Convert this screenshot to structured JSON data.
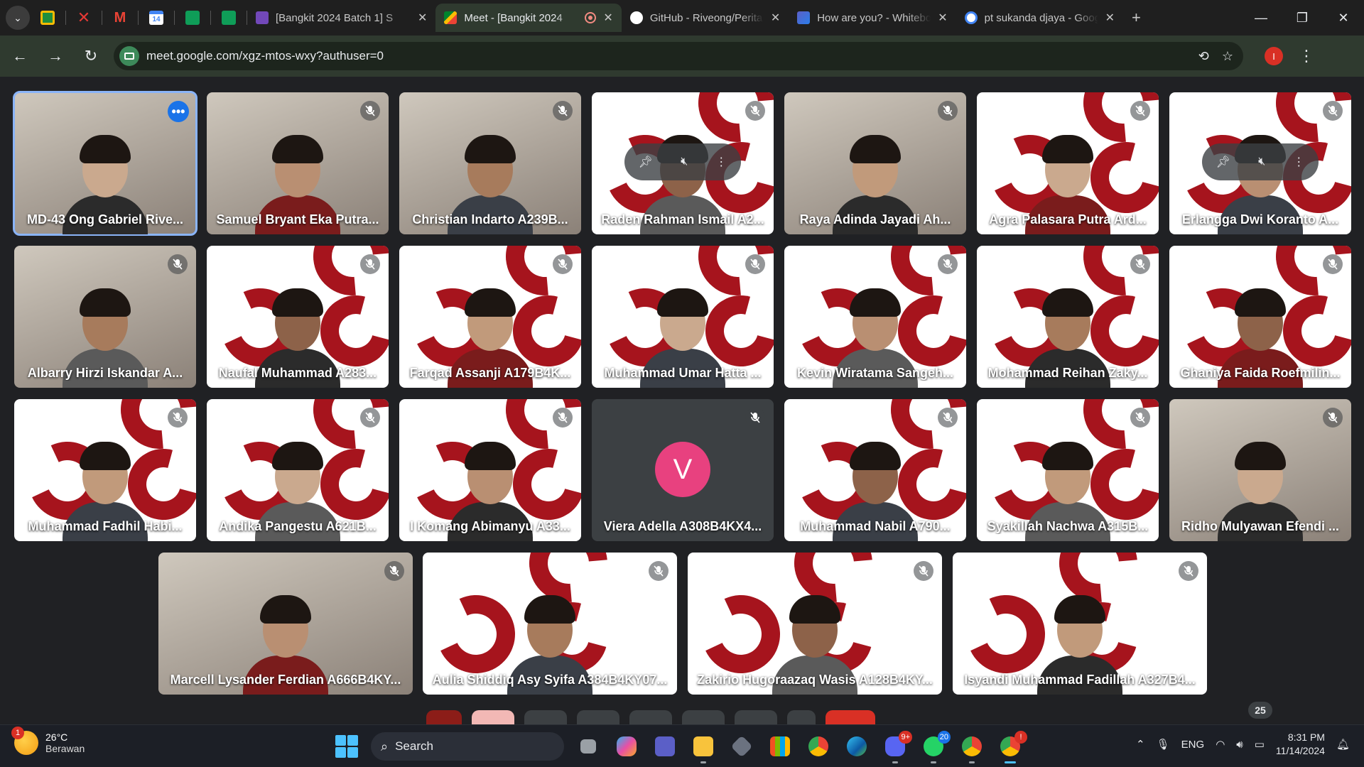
{
  "browser": {
    "tabs": [
      {
        "title": "[Bangkit 2024 Batch 1] S",
        "favicon": "forms-icon",
        "active": false
      },
      {
        "title": "Meet - [Bangkit 2024",
        "favicon": "meet-icon",
        "active": true
      },
      {
        "title": "GitHub - Riveong/Perita",
        "favicon": "github-icon",
        "active": false
      },
      {
        "title": "How are you? - Whitebo",
        "favicon": "whiteboard-icon",
        "active": false
      },
      {
        "title": "pt sukanda djaya - Goog",
        "favicon": "google-icon",
        "active": false
      }
    ],
    "url": "meet.google.com/xgz-mtos-wxy?authuser=0",
    "profile_initial": "I",
    "pinned_badge": "14"
  },
  "participants": [
    {
      "name": "MD-43 Ong Gabriel Rive...",
      "view": "video",
      "active": true
    },
    {
      "name": "Samuel Bryant Eka Putra...",
      "view": "video"
    },
    {
      "name": "Christian Indarto A239B...",
      "view": "video"
    },
    {
      "name": "Raden Rahman Ismail A2...",
      "view": "brand",
      "hover": true
    },
    {
      "name": "Raya Adinda Jayadi Ah...",
      "view": "video"
    },
    {
      "name": "Agra Palasara Putra Ard...",
      "view": "brand"
    },
    {
      "name": "Erlangga Dwi Koranto A...",
      "view": "brand",
      "hover": true
    },
    {
      "name": "Albarry Hirzi Iskandar A...",
      "view": "video"
    },
    {
      "name": "Naufal Muhammad A283...",
      "view": "brand"
    },
    {
      "name": "Farqad Assanji A179B4K...",
      "view": "brand"
    },
    {
      "name": "Muhammad Umar Hatta ...",
      "view": "brand"
    },
    {
      "name": "Kevin Wiratama Sangeh...",
      "view": "brand"
    },
    {
      "name": "Mohammad Reihan Zaky...",
      "view": "brand"
    },
    {
      "name": "Ghaniya Faida Roefmilin...",
      "view": "brand"
    },
    {
      "name": "Muhammad Fadhil Habi...",
      "view": "brand"
    },
    {
      "name": "Andika Pangestu A621B...",
      "view": "brand"
    },
    {
      "name": "I Komang Abimanyu A33...",
      "view": "brand"
    },
    {
      "name": "Viera Adella A308B4KX4...",
      "view": "avatar",
      "initial": "V"
    },
    {
      "name": "Muhammad Nabil A790...",
      "view": "brand"
    },
    {
      "name": "Syakillah Nachwa A315B...",
      "view": "brand"
    },
    {
      "name": "Ridho Mulyawan Efendi ...",
      "view": "video"
    },
    {
      "name": "Marcell Lysander Ferdian A666B4KY...",
      "view": "video"
    },
    {
      "name": "Aulia Shiddiq Asy Syifa A384B4KY07...",
      "view": "brand",
      "logo": "bangkit"
    },
    {
      "name": "Zakirio Hugoraazaq Wasis A128B4KY...",
      "view": "brand",
      "logo": "bangkit"
    },
    {
      "name": "Isyandi Muhammad Fadillah A327B4...",
      "view": "brand",
      "logo": "bangkit"
    }
  ],
  "meet": {
    "participant_count": "25"
  },
  "colors": {
    "accent": "#8ab4f8",
    "brand_red": "#a6141d",
    "avatar_pink": "#e8417f"
  },
  "taskbar": {
    "temperature": "26°C",
    "weather": "Berawan",
    "weather_badge": "1",
    "search_label": "Search",
    "language": "ENG",
    "time": "8:31 PM",
    "date": "11/14/2024",
    "badges": {
      "discord": "9+",
      "whatsapp": "20",
      "chrome": "!"
    }
  }
}
